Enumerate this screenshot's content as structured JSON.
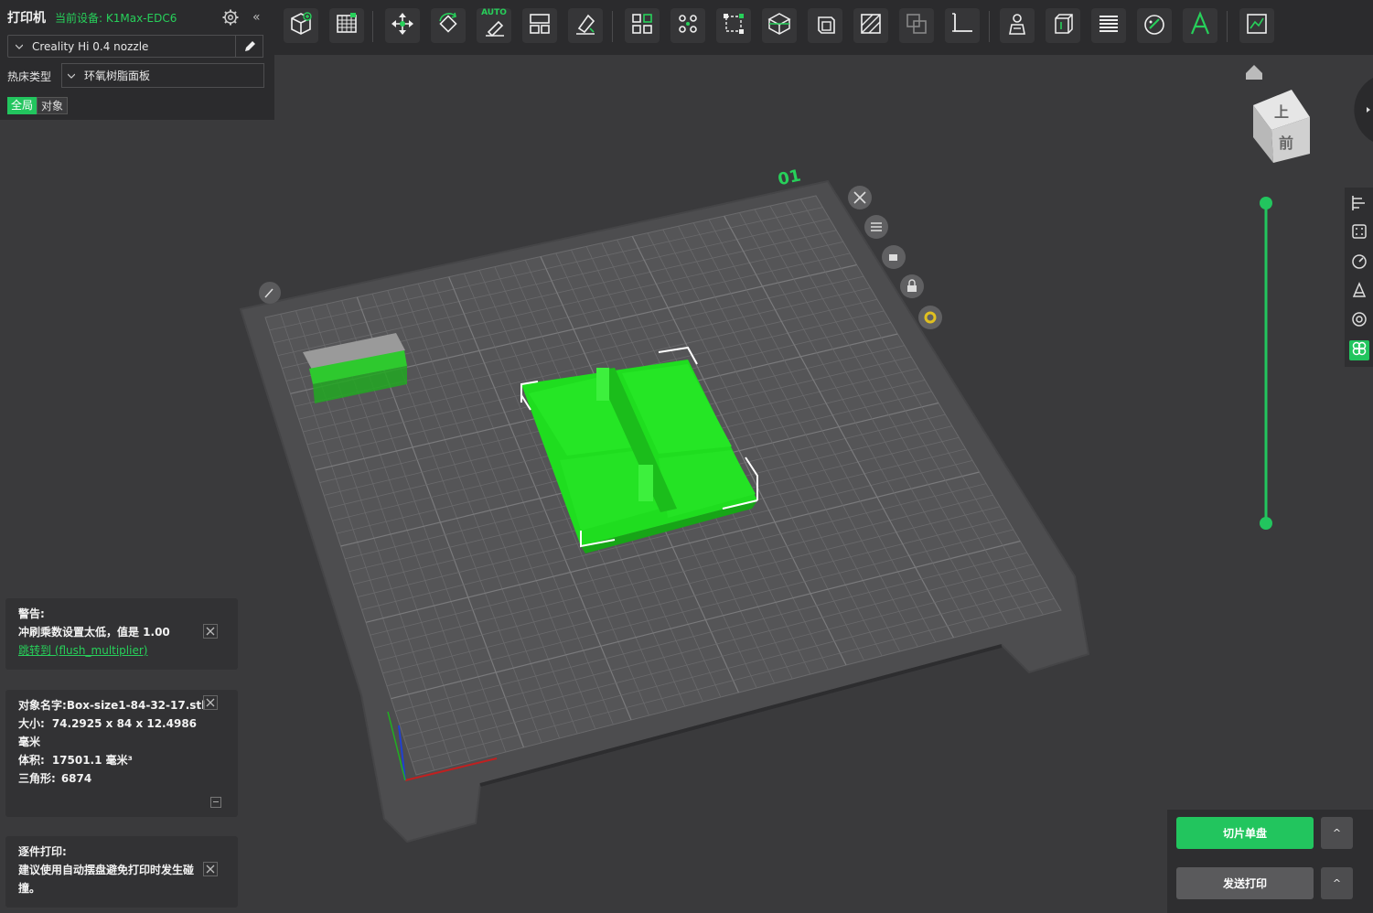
{
  "printer": {
    "title": "打印机",
    "current_device": "当前设备: K1Max-EDC6",
    "nozzle": "Creality Hi 0.4 nozzle",
    "bed_type_label": "热床类型",
    "bed_type_value": "环氧树脂面板",
    "scope_tabs": [
      "全局",
      "对象"
    ],
    "collapse_glyph": "«"
  },
  "toolbar": {
    "icons": [
      "add-object-icon",
      "arrange-grid-icon",
      "move-icon",
      "rotate-icon",
      "auto-orient-icon",
      "split-layout-icon",
      "lay-on-face-icon",
      "split-objects-icon",
      "split-parts-icon",
      "bounding-box-icon",
      "cut-icon",
      "hollow-icon",
      "support-paint-icon",
      "boolean-icon",
      "measure-icon",
      "seam-paint-icon",
      "shell-icon",
      "layers-icon",
      "color-paint-icon",
      "text-icon",
      "assembly-icon"
    ],
    "auto_label": "AUTO"
  },
  "plate": {
    "label": "01"
  },
  "view_cube": {
    "top": "上",
    "front": "前"
  },
  "notifications": {
    "warning": {
      "title": "警告:",
      "message": "冲刷乘数设置太低，值是 1.00",
      "link": "跳转到 (flush_multiplier)"
    },
    "object_info": {
      "name_label": "对象名字:",
      "name_value": "Box-size1-84-32-17.stl",
      "size_label": "大小:",
      "size_value": "74.2925 x 84 x 12.4986",
      "size_unit": "毫米",
      "volume_label": "体积:",
      "volume_value": "17501.1 毫米³",
      "triangles_label": "三角形:",
      "triangles_value": "6874"
    },
    "sequential": {
      "title": "逐件打印:",
      "message": "建议使用自动摆盘避免打印时发生碰撞。"
    }
  },
  "actions": {
    "slice": "切片单盘",
    "send": "发送打印",
    "caret": "^"
  },
  "colors": {
    "accent": "#22c55e",
    "object": "#22dd22",
    "bed": "#4d4d4f"
  }
}
